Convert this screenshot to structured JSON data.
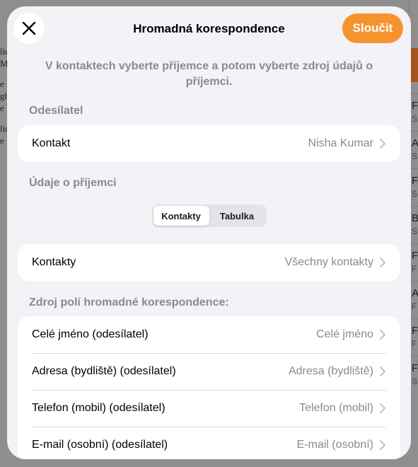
{
  "background": {
    "doc_fragments": [
      "lic",
      "M",
      "e",
      "gh",
      "e",
      "lic",
      "e"
    ],
    "list_initials": [
      {
        "a": "F",
        "b": "S"
      },
      {
        "a": "A",
        "b": "S"
      },
      {
        "a": "F",
        "b": "S"
      },
      {
        "a": "B",
        "b": "S"
      },
      {
        "a": "F",
        "b": "F"
      },
      {
        "a": "A",
        "b": "F"
      },
      {
        "a": "F",
        "b": "F"
      },
      {
        "a": "F",
        "b": "S"
      }
    ]
  },
  "sheet": {
    "title": "Hromadná korespondence",
    "close_icon": "close-icon",
    "primary_action": "Sloučit",
    "intro": "V kontaktech vyberte příjemce a potom vyberte zdroj údajů o příjemci.",
    "sender_section": {
      "label": "Odesílatel",
      "row": {
        "label": "Kontakt",
        "value": "Nisha Kumar"
      }
    },
    "recipient_section": {
      "label": "Údaje o příjemci",
      "segments": [
        "Kontakty",
        "Tabulka"
      ],
      "selected_segment": "Kontakty",
      "row": {
        "label": "Kontakty",
        "value": "Všechny kontakty"
      }
    },
    "fields_section": {
      "label": "Zdroj polí hromadné korespondence:",
      "rows": [
        {
          "label": "Celé jméno (odesílatel)",
          "value": "Celé jméno"
        },
        {
          "label": "Adresa (bydliště) (odesílatel)",
          "value": "Adresa (bydliště)"
        },
        {
          "label": "Telefon (mobil) (odesílatel)",
          "value": "Telefon (mobil)"
        },
        {
          "label": "E-mail (osobní) (odesílatel)",
          "value": "E-mail (osobní)"
        }
      ]
    }
  },
  "colors": {
    "accent": "#f7932f",
    "sheet_bg": "#f2f2f7",
    "secondary_text": "#8a8a8e"
  }
}
